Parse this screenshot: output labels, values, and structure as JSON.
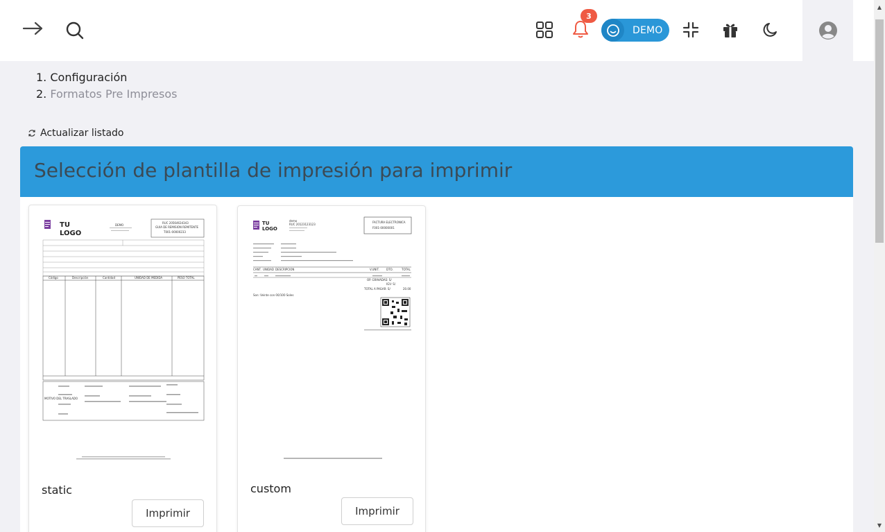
{
  "topbar": {
    "notifications_count": "3",
    "demo_label": "DEMO",
    "icons": [
      "arrow-right-icon",
      "search-icon",
      "apps-icon",
      "bell-icon",
      "smiley-icon",
      "collapse-icon",
      "gift-icon",
      "moon-icon",
      "user-circle-icon"
    ]
  },
  "breadcrumb": {
    "items": [
      {
        "num": "1.",
        "label": "Configuración"
      },
      {
        "num": "2.",
        "label": "Formatos Pre Impresos"
      }
    ]
  },
  "refresh_label": "Actualizar listado",
  "panel": {
    "title": "Selección de plantilla de impresión para imprimir"
  },
  "templates": [
    {
      "name": "static",
      "button": "Imprimir"
    },
    {
      "name": "custom",
      "button": "Imprimir"
    }
  ],
  "preview_static": {
    "logo_line1": "TU",
    "logo_line2": "LOGO",
    "ruc_line": "RUC 20564634343",
    "doc_type": "GUIA DE REMISION REMITENTE",
    "doc_number": "T001-00000233",
    "company": "DEMO",
    "columns": [
      "Código",
      "Descripción",
      "Cantidad",
      "UNIDAD DE MEDIDA",
      "PESO TOTAL"
    ],
    "reason_label": "MOTIVO DEL TRASLADO"
  },
  "preview_custom": {
    "logo_line1": "TU",
    "logo_line2": "LOGO",
    "company": "demo",
    "ruc_line": "RUC 20123123123",
    "doc_type": "FACTURA ELECTRONICA",
    "doc_number": "F001-00000001",
    "columns": [
      "CANT.",
      "UNIDAD",
      "DESCRIPCION",
      "V.UNIT.",
      "DTO.",
      "TOTAL"
    ],
    "op_gravadas": "OP. GRAVADAS: S/",
    "igv": "IGV: S/",
    "total_label": "TOTAL A PAGAR: S/",
    "total_value": "20.00",
    "son": "Son: Veinte con 00/100 Soles"
  },
  "colors": {
    "accent": "#2c9adb",
    "badge": "#ef5a43",
    "logo": "#7b3fa0"
  }
}
